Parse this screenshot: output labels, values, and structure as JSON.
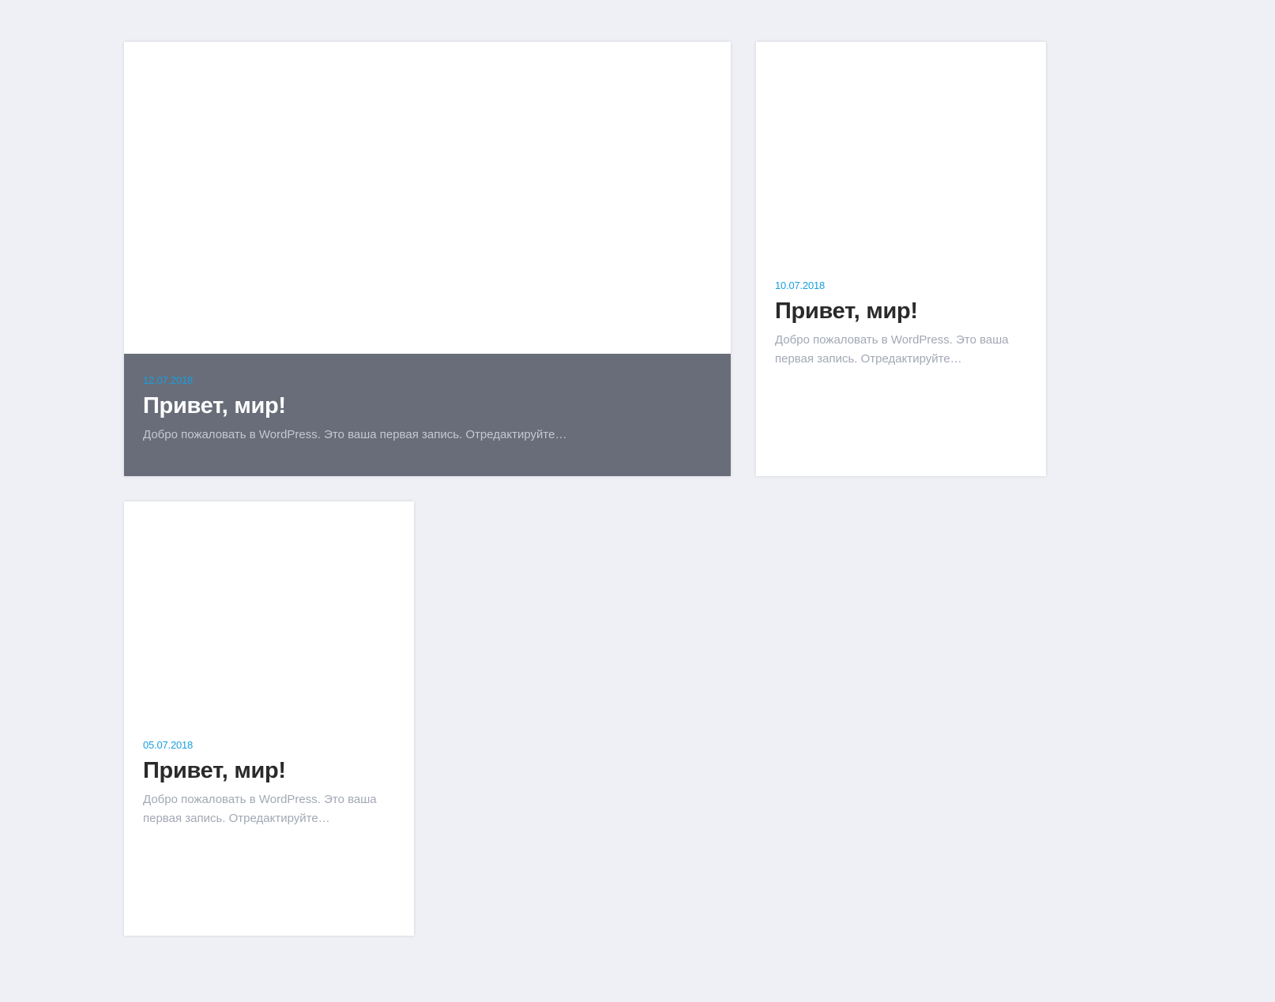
{
  "posts": [
    {
      "date": "12.07.2018",
      "title": "Привет, мир!",
      "excerpt": "Добро пожаловать в WordPress. Это ваша первая запись. Отредактируйте…"
    },
    {
      "date": "10.07.2018",
      "title": "Привет, мир!",
      "excerpt": "Добро пожаловать в WordPress. Это ваша первая запись. Отредактируйте…"
    },
    {
      "date": "05.07.2018",
      "title": "Привет, мир!",
      "excerpt": "Добро пожаловать в WordPress. Это ваша первая запись. Отредактируйте…"
    }
  ],
  "colors": {
    "background": "#eff0f5",
    "card": "#ffffff",
    "overlay": "#686d79",
    "date": "#1a9ee0",
    "title": "#2a2a2a",
    "excerpt": "#a2a8b4"
  }
}
